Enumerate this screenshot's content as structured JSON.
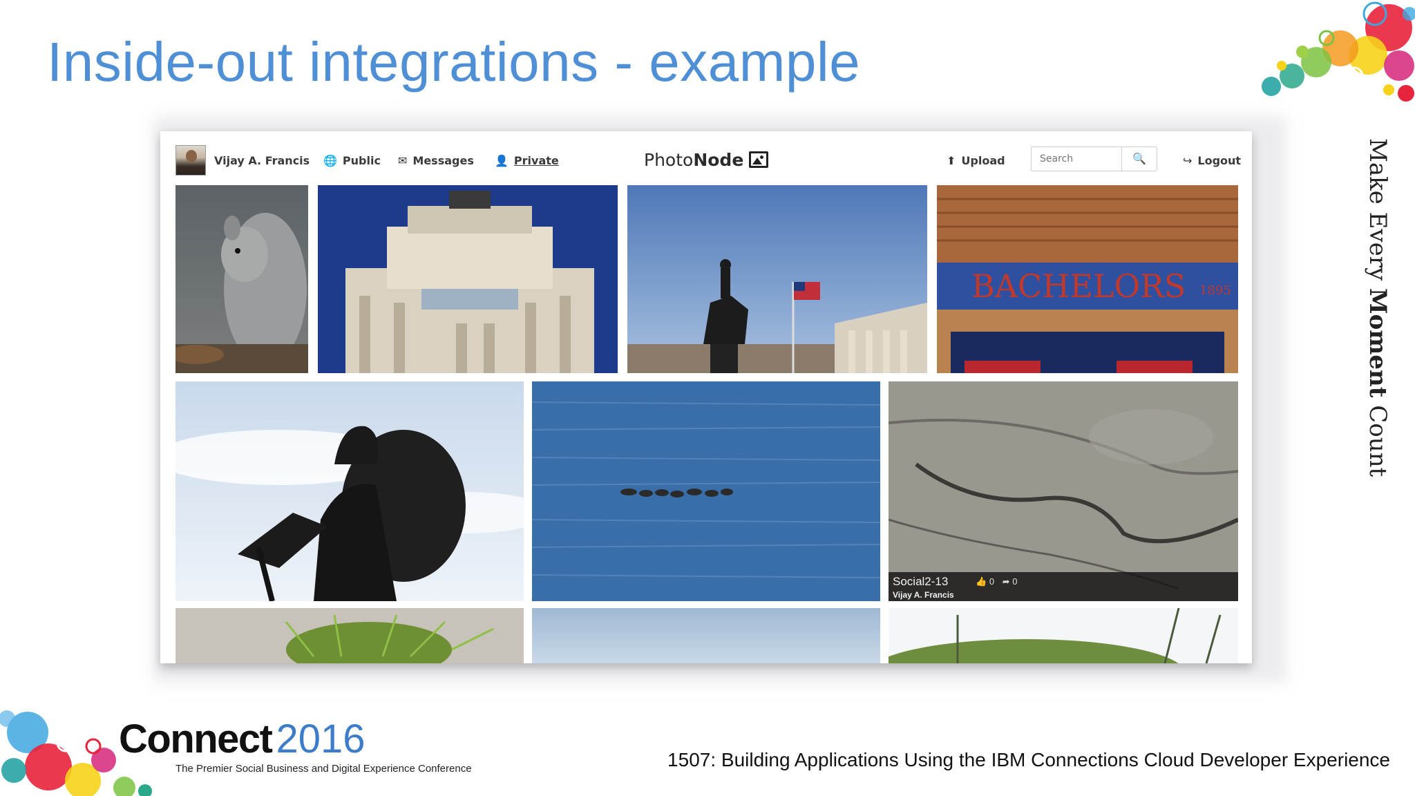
{
  "slide": {
    "title": "Inside-out integrations - example",
    "tagline_pre": "Make Every ",
    "tagline_bold": "Moment",
    "tagline_post": " Count"
  },
  "app": {
    "user_name": "Vijay A. Francis",
    "nav": {
      "public": "Public",
      "messages": "Messages",
      "private": "Private",
      "upload": "Upload",
      "logout": "Logout"
    },
    "brand_light": "Photo",
    "brand_bold": "Node",
    "search": {
      "placeholder": "Search"
    },
    "photos": [
      {
        "subject": "squirrel"
      },
      {
        "subject": "clock-tower"
      },
      {
        "subject": "equestrian-statue-with-flag"
      },
      {
        "subject": "bachelors-sign",
        "sign_text": "BACHELORS",
        "sign_year": "1895"
      },
      {
        "subject": "viking-statue"
      },
      {
        "subject": "ducks-on-water"
      },
      {
        "subject": "rock-surface",
        "caption": {
          "title": "Social2-13",
          "user": "Vijay A. Francis",
          "likes": "0",
          "shares": "0"
        }
      },
      {
        "subject": "pine-branch"
      },
      {
        "subject": "sky"
      },
      {
        "subject": "hill-with-trees"
      }
    ]
  },
  "footer": {
    "logo_main": "Connect",
    "logo_year": "2016",
    "logo_sub": "The Premier Social Business and Digital Experience Conference",
    "session": "1507: Building Applications Using the IBM Connections Cloud Developer Experience"
  },
  "colors": {
    "title": "#4f8fd6",
    "logo_year": "#3d7cc9"
  }
}
